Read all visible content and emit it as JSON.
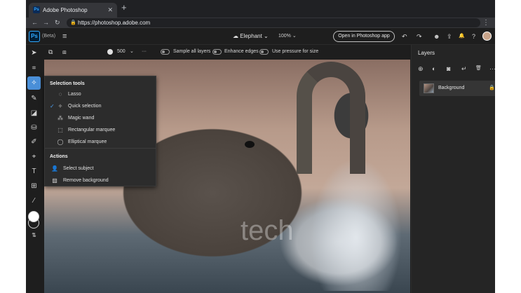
{
  "browser": {
    "tab_title": "Adobe Photoshop",
    "tab_favicon": "Ps",
    "tab_close": "✕",
    "new_tab": "+",
    "url": "https://photoshop.adobe.com",
    "back": "←",
    "forward": "→",
    "reload": "↻",
    "lock": "🔒",
    "menu": "⋮"
  },
  "app": {
    "logo": "Ps",
    "beta_label": "(Beta)",
    "menu_glyph": "≡",
    "document_name": "Elephant",
    "zoom": "100%",
    "open_app_button": "Open in Photoshop app",
    "undo": "↶",
    "redo": "↷",
    "header_icons": {
      "accessibility": "☻",
      "share": "⇪",
      "notifications": "🔔",
      "help": "?"
    }
  },
  "options": {
    "brush_size": "500",
    "more": "···",
    "sample_all_layers": "Sample all layers",
    "enhance_edges": "Enhance edges",
    "use_pressure": "Use pressure for size"
  },
  "tools": [
    {
      "name": "move-tool",
      "glyph": "➤"
    },
    {
      "name": "transform-tool",
      "glyph": "⌗"
    },
    {
      "name": "quick-selection-tool",
      "glyph": "✧",
      "active": true
    },
    {
      "name": "brush-tool",
      "glyph": "✎"
    },
    {
      "name": "eraser-tool",
      "glyph": "◪"
    },
    {
      "name": "paint-bucket-tool",
      "glyph": "⛁"
    },
    {
      "name": "spot-healing-tool",
      "glyph": "✐"
    },
    {
      "name": "crop-tool",
      "glyph": "⌖"
    },
    {
      "name": "type-tool",
      "glyph": "T"
    },
    {
      "name": "place-image-tool",
      "glyph": "⊞"
    },
    {
      "name": "eyedropper-tool",
      "glyph": "⁄"
    },
    {
      "name": "swap-colors",
      "glyph": "⇅"
    }
  ],
  "popover": {
    "selection_heading": "Selection tools",
    "selection_items": [
      {
        "label": "Lasso",
        "icon": "lasso-icon",
        "glyph": "◌",
        "checked": false
      },
      {
        "label": "Quick selection",
        "icon": "quick-selection-icon",
        "glyph": "✧",
        "checked": true
      },
      {
        "label": "Magic wand",
        "icon": "magic-wand-icon",
        "glyph": "⁂",
        "checked": false
      },
      {
        "label": "Rectangular marquee",
        "icon": "rectangular-marquee-icon",
        "glyph": "⬚",
        "checked": false
      },
      {
        "label": "Elliptical marquee",
        "icon": "elliptical-marquee-icon",
        "glyph": "◯",
        "checked": false
      }
    ],
    "check_glyph": "✓",
    "actions_heading": "Actions",
    "action_items": [
      {
        "label": "Select subject",
        "icon": "select-subject-icon",
        "glyph": "👤"
      },
      {
        "label": "Remove background",
        "icon": "remove-background-icon",
        "glyph": "▨"
      }
    ]
  },
  "canvas": {
    "watermark": "tech"
  },
  "layers_panel": {
    "title": "Layers",
    "toolbar_icons": [
      {
        "name": "add-layer-icon",
        "glyph": "⊕"
      },
      {
        "name": "adjustment-icon",
        "glyph": "◐"
      },
      {
        "name": "mask-icon",
        "glyph": "◙"
      },
      {
        "name": "clip-icon",
        "glyph": "↵"
      },
      {
        "name": "delete-layer-icon",
        "glyph": "🗑"
      },
      {
        "name": "more-options-icon",
        "glyph": "···"
      }
    ],
    "layers": [
      {
        "name": "Background",
        "locked": true,
        "lock_glyph": "🔒"
      }
    ]
  },
  "right_rail": [
    {
      "name": "layers-panel-icon",
      "glyph": "❏",
      "active": true
    },
    {
      "name": "adjustments-panel-icon",
      "glyph": "☰"
    },
    {
      "name": "comments-panel-icon",
      "glyph": "▭"
    },
    {
      "name": "info-panel-icon",
      "glyph": "ⓘ"
    }
  ],
  "colors": {
    "accent": "#4a8fd8",
    "app_bg": "#1e1e1e",
    "panel_bg": "#252525",
    "foreground_color": "#ffffff",
    "background_color": "#1e1e1e"
  }
}
